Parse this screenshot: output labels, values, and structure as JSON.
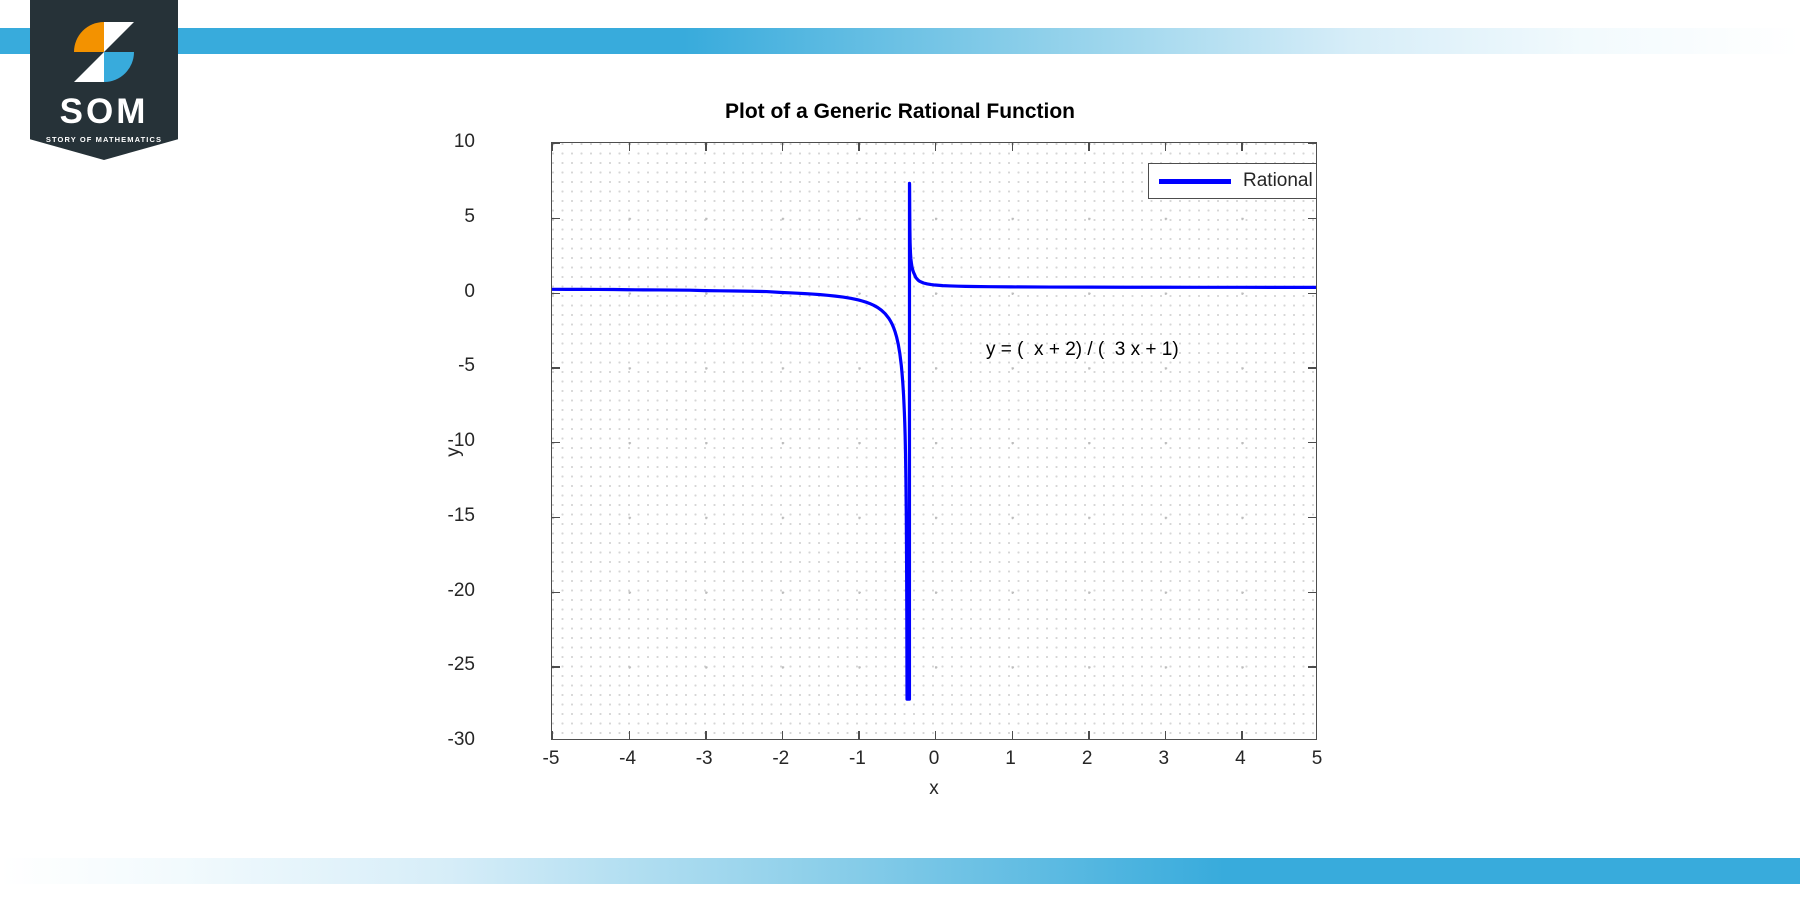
{
  "branding": {
    "logo_text": "SOM",
    "logo_subtitle": "STORY OF MATHEMATICS",
    "accent_blue": "#38abdc",
    "badge_dark": "#263238",
    "logo_orange": "#f39200"
  },
  "figure": {
    "title": "Plot of a Generic Rational Function",
    "equation_annotation": "y = (  x + 2) / (  3 x + 1)",
    "legend": {
      "entries": [
        {
          "label": "Rational Function",
          "color": "#0000ff"
        }
      ]
    }
  },
  "chart_data": {
    "type": "line",
    "title": "Plot of a Generic Rational Function",
    "xlabel": "x",
    "ylabel": "y",
    "xlim": [
      -5,
      5
    ],
    "ylim": [
      -30,
      10
    ],
    "xticks": [
      "-5",
      "-4",
      "-3",
      "-2",
      "-1",
      "0",
      "1",
      "2",
      "3",
      "4",
      "5"
    ],
    "xtick_values": [
      -5,
      -4,
      -3,
      -2,
      -1,
      0,
      1,
      2,
      3,
      4,
      5
    ],
    "yticks": [
      "10",
      "5",
      "0",
      "-5",
      "-10",
      "-15",
      "-20",
      "-25",
      "-30"
    ],
    "ytick_values": [
      10,
      5,
      0,
      -5,
      -10,
      -15,
      -20,
      -25,
      -30
    ],
    "grid": true,
    "legend_position": "top-right",
    "annotation": "y = (  x + 2) / (  3 x + 1)",
    "expression": "(x + 2) / (3 x + 1)",
    "vertical_asymptote": -0.3333,
    "horizontal_asymptote": 0.3333,
    "series": [
      {
        "name": "Rational Function",
        "color": "#0000ff",
        "linewidth": 3,
        "points": [
          [
            -5.0,
            0.2143
          ],
          [
            -4.8,
            0.2117
          ],
          [
            -4.6,
            0.209
          ],
          [
            -4.4,
            0.2059
          ],
          [
            -4.2,
            0.2025
          ],
          [
            -4.0,
            0.1818
          ],
          [
            -3.8,
            0.1765
          ],
          [
            -3.6,
            0.1702
          ],
          [
            -3.4,
            0.1633
          ],
          [
            -3.2,
            0.1552
          ],
          [
            -3.0,
            0.125
          ],
          [
            -2.8,
            0.1136
          ],
          [
            -2.6,
            0.1
          ],
          [
            -2.4,
            0.0833
          ],
          [
            -2.2,
            0.0625
          ],
          [
            -2.0,
            0.0
          ],
          [
            -1.9,
            -0.0204
          ],
          [
            -1.8,
            -0.0455
          ],
          [
            -1.7,
            -0.075
          ],
          [
            -1.6,
            -0.1053
          ],
          [
            -1.5,
            -0.1429
          ],
          [
            -1.4,
            -0.1875
          ],
          [
            -1.3,
            -0.2414
          ],
          [
            -1.2,
            -0.3077
          ],
          [
            -1.1,
            -0.3913
          ],
          [
            -1.0,
            -0.5
          ],
          [
            -0.95,
            -0.5676
          ],
          [
            -0.9,
            -0.6471
          ],
          [
            -0.85,
            -0.7419
          ],
          [
            -0.8,
            -0.8571
          ],
          [
            -0.75,
            -1.0
          ],
          [
            -0.7,
            -1.1818
          ],
          [
            -0.65,
            -1.4211
          ],
          [
            -0.6,
            -1.75
          ],
          [
            -0.58,
            -1.9189
          ],
          [
            -0.56,
            -2.1176
          ],
          [
            -0.54,
            -2.3548
          ],
          [
            -0.52,
            -2.6429
          ],
          [
            -0.5,
            -3.0
          ],
          [
            -0.48,
            -3.4545
          ],
          [
            -0.46,
            -4.0526
          ],
          [
            -0.44,
            -4.875
          ],
          [
            -0.43,
            -5.4194
          ],
          [
            -0.42,
            -6.0769
          ],
          [
            -0.41,
            -6.8824
          ],
          [
            -0.4,
            -8.0
          ],
          [
            -0.395,
            -8.6842
          ],
          [
            -0.39,
            -9.5652
          ],
          [
            -0.385,
            -10.7391
          ],
          [
            -0.38,
            -12.381
          ],
          [
            -0.375,
            -14.8333
          ],
          [
            -0.372,
            -17.0588
          ],
          [
            -0.37,
            -19.0909
          ],
          [
            -0.368,
            -21.7826
          ],
          [
            -0.366,
            -25.5294
          ],
          [
            -0.3655,
            -26.85
          ],
          [
            -0.365,
            -27.2
          ],
          [
            -0.3335,
            -27.2
          ],
          [
            -0.333,
            7.3
          ],
          [
            -0.332,
            7.25
          ],
          [
            -0.33,
            5.5667
          ],
          [
            -0.328,
            4.2632
          ],
          [
            -0.325,
            3.3333
          ],
          [
            -0.32,
            2.625
          ],
          [
            -0.315,
            2.2636
          ],
          [
            -0.31,
            2.0286
          ],
          [
            -0.3,
            1.7
          ],
          [
            -0.29,
            1.4923
          ],
          [
            -0.28,
            1.3438
          ],
          [
            -0.27,
            1.2316
          ],
          [
            -0.25,
            1.0
          ],
          [
            -0.22,
            0.8235
          ],
          [
            -0.2,
            0.75
          ],
          [
            -0.15,
            0.6364
          ],
          [
            -0.1,
            0.5714
          ],
          [
            -0.05,
            0.5294
          ],
          [
            0.0,
            0.5
          ],
          [
            0.1,
            0.4615
          ],
          [
            0.2,
            0.4375
          ],
          [
            0.3,
            0.4211
          ],
          [
            0.4,
            0.4091
          ],
          [
            0.5,
            0.4
          ],
          [
            0.7,
            0.3871
          ],
          [
            1.0,
            0.375
          ],
          [
            1.5,
            0.3636
          ],
          [
            2.0,
            0.3571
          ],
          [
            2.5,
            0.3529
          ],
          [
            3.0,
            0.35
          ],
          [
            3.5,
            0.3478
          ],
          [
            4.0,
            0.3462
          ],
          [
            4.5,
            0.3448
          ],
          [
            5.0,
            0.3437
          ]
        ]
      }
    ]
  }
}
